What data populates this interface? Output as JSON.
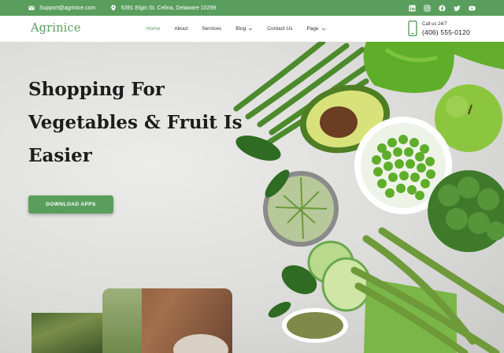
{
  "topbar": {
    "email": "Support@agrinice.com",
    "address": "6391 Elgin St. Celina, Delaware 10299",
    "socials": [
      "linkedin-icon",
      "instagram-icon",
      "facebook-icon",
      "twitter-icon",
      "youtube-icon"
    ]
  },
  "brand": {
    "logo": "Agrinice",
    "accent": "#5a9e5e"
  },
  "nav": {
    "home": "Home",
    "about": "About",
    "services": "Services",
    "blog": "Blog",
    "contact": "Contact Us",
    "page": "Page",
    "active": "Home"
  },
  "call": {
    "label": "Call us 24/7",
    "number": "(406) 555-0120"
  },
  "hero": {
    "line1": "Shopping For",
    "line2": "Vegetables & Fruit Is",
    "line3": "Easier",
    "cta": "DOWNLOAD APPS"
  }
}
